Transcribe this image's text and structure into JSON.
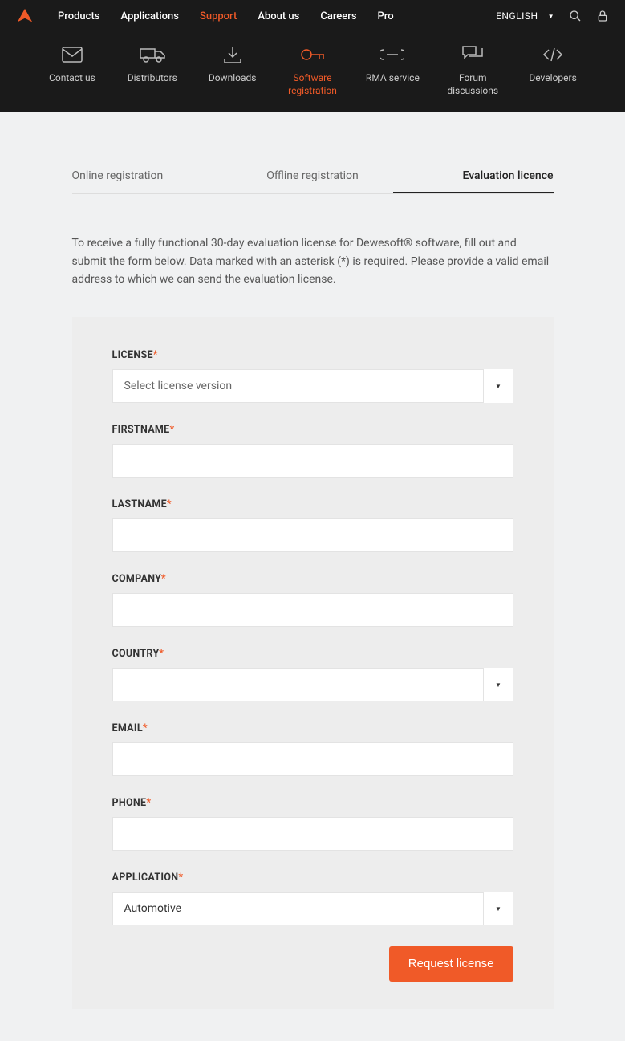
{
  "nav": {
    "items": [
      "Products",
      "Applications",
      "Support",
      "About us",
      "Careers",
      "Pro"
    ],
    "active_index": 2,
    "lang": "ENGLISH"
  },
  "subnav": {
    "items": [
      {
        "label": "Contact us"
      },
      {
        "label": "Distributors"
      },
      {
        "label": "Downloads"
      },
      {
        "label": "Software registration"
      },
      {
        "label": "RMA service"
      },
      {
        "label": "Forum discussions"
      },
      {
        "label": "Developers"
      }
    ],
    "active_index": 3
  },
  "tabs": {
    "items": [
      "Online registration",
      "Offline registration",
      "Evaluation licence"
    ],
    "active_index": 2
  },
  "intro": "To receive a fully functional 30-day evaluation license for Dewesoft® software, fill out and submit the form below. Data marked with an asterisk (*) is required. Please provide a valid email address to which we can send the evaluation license.",
  "form": {
    "license": {
      "label": "LICENSE",
      "placeholder": "Select license version",
      "value": ""
    },
    "firstname": {
      "label": "FIRSTNAME",
      "value": ""
    },
    "lastname": {
      "label": "LASTNAME",
      "value": ""
    },
    "company": {
      "label": "COMPANY",
      "value": ""
    },
    "country": {
      "label": "COUNTRY",
      "value": ""
    },
    "email": {
      "label": "EMAIL",
      "value": ""
    },
    "phone": {
      "label": "PHONE",
      "value": ""
    },
    "application": {
      "label": "APPLICATION",
      "value": "Automotive"
    },
    "submit": "Request license"
  }
}
